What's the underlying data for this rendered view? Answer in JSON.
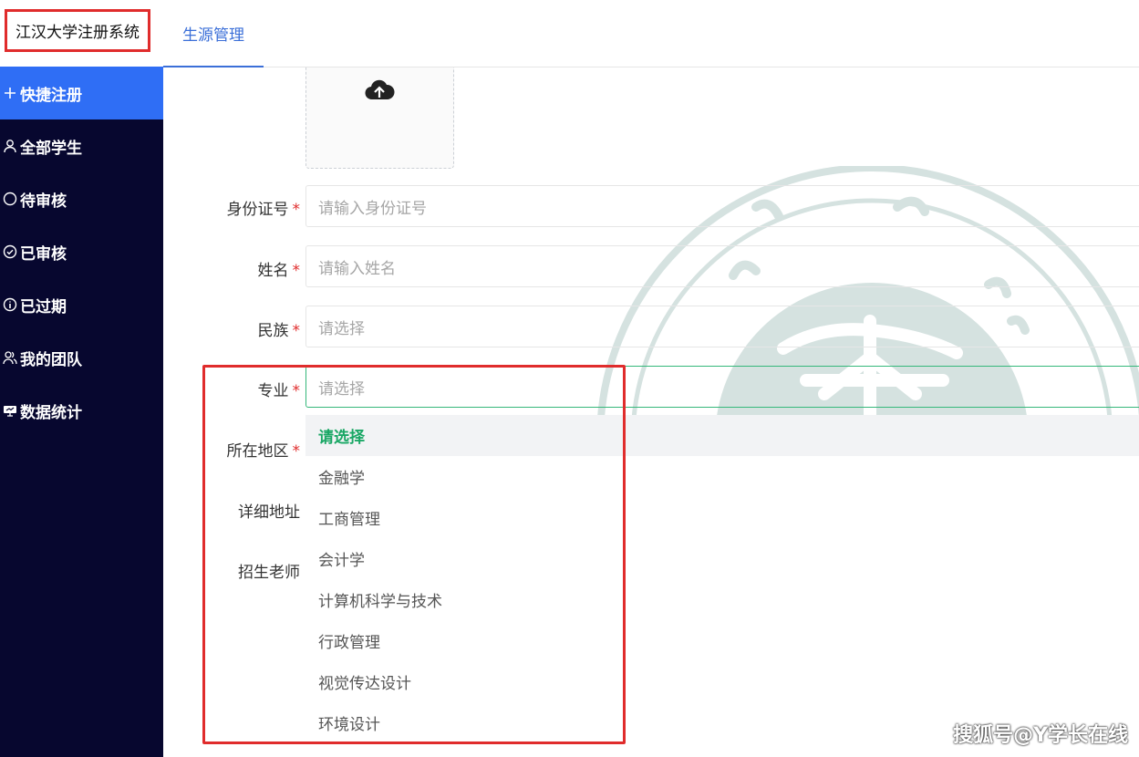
{
  "header": {
    "brand": "江汉大学注册系统",
    "tab": "生源管理"
  },
  "sidebar": {
    "items": [
      {
        "label": "快捷注册",
        "icon": "plus-icon",
        "active": true
      },
      {
        "label": "全部学生",
        "icon": "user-icon",
        "active": false
      },
      {
        "label": "待审核",
        "icon": "circle-icon",
        "active": false
      },
      {
        "label": "已审核",
        "icon": "check-circle-icon",
        "active": false
      },
      {
        "label": "已过期",
        "icon": "info-circle-icon",
        "active": false
      },
      {
        "label": "我的团队",
        "icon": "team-icon",
        "active": false
      },
      {
        "label": "数据统计",
        "icon": "chart-icon",
        "active": false
      }
    ]
  },
  "form": {
    "upload_icon": "cloud-upload-icon",
    "id_label": "身份证号",
    "id_placeholder": "请输入身份证号",
    "name_label": "姓名",
    "name_placeholder": "请输入姓名",
    "ethnicity_label": "民族",
    "ethnicity_placeholder": "请选择",
    "major_label": "专业",
    "major_placeholder": "请选择",
    "region_label": "所在地区",
    "address_label": "详细地址",
    "teacher_label": "招生老师",
    "required_mark": "*"
  },
  "dropdown": {
    "options": [
      "请选择",
      "金融学",
      "工商管理",
      "会计学",
      "计算机科学与技术",
      "行政管理",
      "视觉传达设计",
      "环境设计"
    ],
    "selected_index": 0
  },
  "watermark": "搜狐号@Y学长在线",
  "colors": {
    "sidebar_bg": "#07072f",
    "active_item": "#2f6ef5",
    "accent_tab": "#3b6fd8",
    "selected_option": "#1aa765",
    "required": "#e02c2c",
    "highlight_box": "#e02c2c",
    "seal": "#d5e2e0"
  }
}
